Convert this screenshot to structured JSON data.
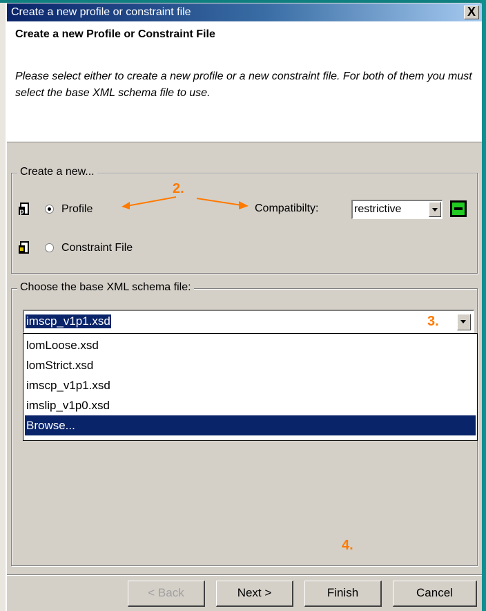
{
  "window": {
    "title": "Create a new profile or constraint file",
    "close_label": "X"
  },
  "header": {
    "title": "Create a new Profile or Constraint File",
    "description": "Please select either to create a new profile or a new constraint file. For both of them you must select the base XML schema file to use."
  },
  "create_group": {
    "legend": "Create a new...",
    "profile_label": "Profile",
    "profile_selected": true,
    "constraint_label": "Constraint File",
    "constraint_selected": false,
    "compat_label": "Compatibilty:",
    "compat_value": "restrictive"
  },
  "schema_group": {
    "legend": "Choose the base XML schema file:",
    "selected_value": "imscp_v1p1.xsd",
    "options": [
      "lomLoose.xsd",
      "lomStrict.xsd",
      "imscp_v1p1.xsd",
      "imslip_v1p0.xsd",
      "Browse..."
    ],
    "highlighted_option": "Browse..."
  },
  "annotations": {
    "a2": "2.",
    "a3": "3.",
    "a4": "4."
  },
  "buttons": {
    "back": "< Back",
    "next": "Next >",
    "finish": "Finish",
    "cancel": "Cancel"
  },
  "colors": {
    "accent": "#ff7a00",
    "selection": "#0a246a",
    "desktop": "#0f7f7f"
  }
}
